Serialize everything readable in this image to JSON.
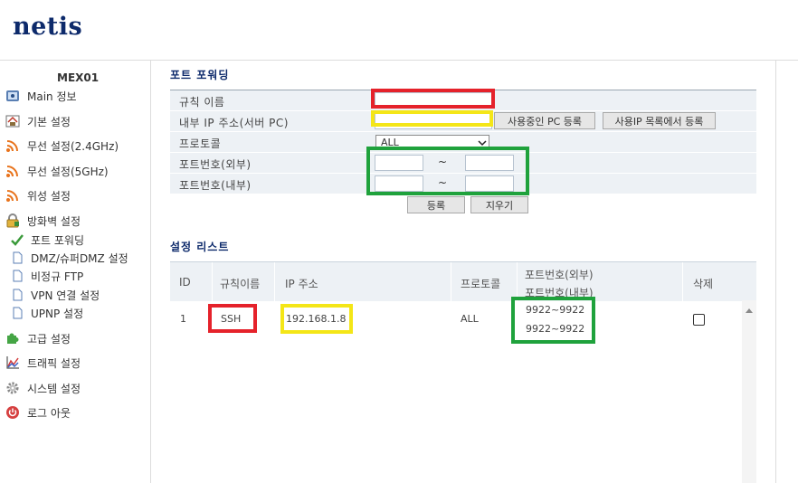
{
  "header": {
    "logo": "netis"
  },
  "sidebar": {
    "model": "MEX01",
    "items": [
      {
        "label": "Main 정보",
        "icon": "info-icon"
      },
      {
        "label": "기본 설정",
        "icon": "home-icon"
      },
      {
        "label": "무선 설정(2.4GHz)",
        "icon": "wireless-icon"
      },
      {
        "label": "무선 설정(5GHz)",
        "icon": "wireless-icon"
      },
      {
        "label": "위성 설정",
        "icon": "wireless-icon"
      },
      {
        "label": "방화벽 설정",
        "icon": "lock-icon"
      },
      {
        "label": "고급 설정",
        "icon": "puzzle-icon"
      },
      {
        "label": "트래픽 설정",
        "icon": "chart-icon"
      },
      {
        "label": "시스템 설정",
        "icon": "gear-icon"
      },
      {
        "label": "로그 아웃",
        "icon": "power-icon"
      }
    ],
    "subitems": [
      {
        "label": "포트 포워딩",
        "icon": "check-icon"
      },
      {
        "label": "DMZ/슈퍼DMZ 설정",
        "icon": "page-icon"
      },
      {
        "label": "비정규 FTP",
        "icon": "page-icon"
      },
      {
        "label": "VPN 연결 설정",
        "icon": "page-icon"
      },
      {
        "label": "UPNP 설정",
        "icon": "page-icon"
      }
    ]
  },
  "form": {
    "title": "포트 포워딩",
    "rule_name_label": "규칙 이름",
    "rule_name_value": "",
    "internal_ip_label": "내부 IP 주소(서버 PC)",
    "internal_ip_value": "",
    "btn_current_pc": "사용중인 PC 등록",
    "btn_ip_list": "사용IP 목록에서 등록",
    "protocol_label": "프로토콜",
    "protocol_value": "ALL",
    "ext_port_label": "포트번호(외부)",
    "int_port_label": "포트번호(내부)",
    "tilde": "~",
    "btn_register": "등록",
    "btn_clear": "지우기"
  },
  "list": {
    "title": "설정 리스트",
    "headers": {
      "id": "ID",
      "rule_name": "규칙이름",
      "ip": "IP 주소",
      "protocol": "프로토콜",
      "port_ext": "포트번호(외부)",
      "port_int": "포트번호(내부)",
      "delete": "삭제"
    },
    "rows": [
      {
        "id": "1",
        "rule_name": "SSH",
        "ip": "192.168.1.8",
        "protocol": "ALL",
        "port_ext": "9922~9922",
        "port_int": "9922~9922",
        "delete_checked": false
      }
    ]
  },
  "colors": {
    "brand": "#0d2a6b",
    "highlight_red": "#e5222b",
    "highlight_yellow": "#f4e617",
    "highlight_green": "#1fa23c"
  }
}
